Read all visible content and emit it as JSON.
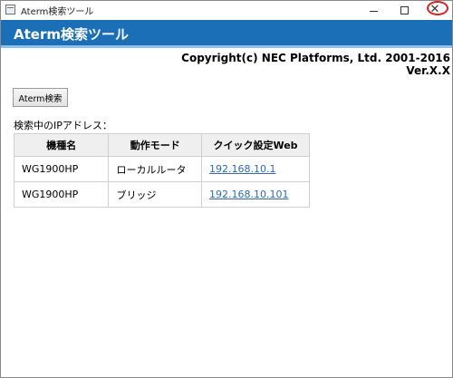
{
  "window": {
    "title": "Aterm検索ツール",
    "controls": {
      "minimize": "",
      "maximize": "",
      "close": "✕"
    }
  },
  "header": {
    "title": "Aterm検索ツール",
    "brand_color": "#1b6fb7"
  },
  "copyright": {
    "line1": "Copyright(c) NEC Platforms, Ltd. 2001-2016",
    "line2": "Ver.X.X"
  },
  "search_button": {
    "label": "Aterm検索"
  },
  "results": {
    "label": "検索中のIPアドレス：",
    "columns": [
      "機種名",
      "動作モード",
      "クイック設定Web"
    ],
    "rows": [
      {
        "model": "WG1900HP",
        "mode": "ローカルルータ",
        "ip": "192.168.10.1"
      },
      {
        "model": "WG1900HP",
        "mode": "ブリッジ",
        "ip": "192.168.10.101"
      }
    ]
  },
  "icons": {
    "app": "app-window-icon",
    "minimize": "minimize-icon",
    "maximize": "maximize-icon",
    "close": "close-icon"
  },
  "highlight_color": "#e0201c"
}
